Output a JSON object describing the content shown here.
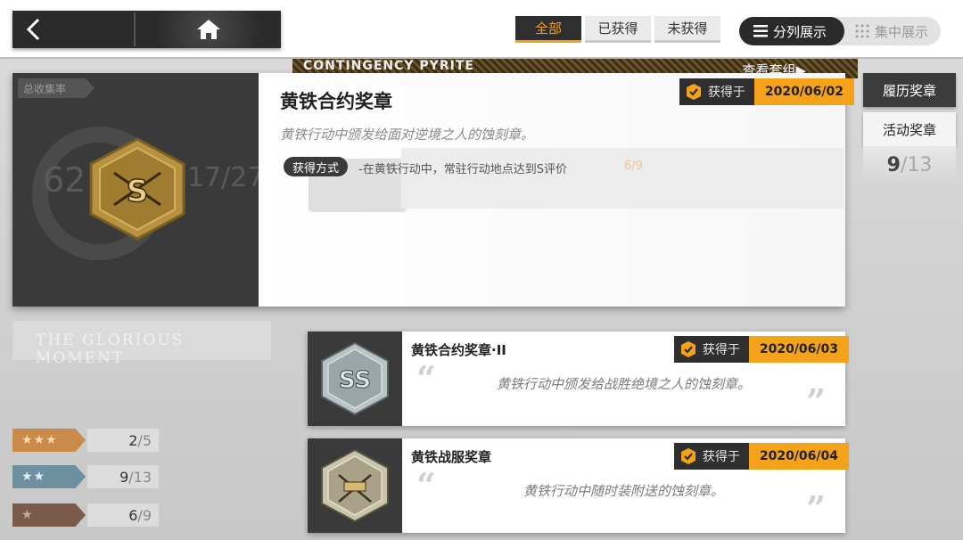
{
  "nav": {
    "back_icon": "chevron-left-icon",
    "home_icon": "home-icon"
  },
  "filters": [
    {
      "label": "全部",
      "active": true
    },
    {
      "label": "已获得",
      "active": false
    },
    {
      "label": "未获得",
      "active": false
    }
  ],
  "view_toggle": {
    "column_label": "分列展示",
    "focus_label": "集中展示"
  },
  "background": {
    "banner_left": "CONTINGENCY PYRITE",
    "banner_right": "查看套组▶",
    "glory_text": "THE GLORIOUS MOMENT",
    "collection_label": "总收集率",
    "collection_percent": "62",
    "collection_fraction": "17/27",
    "ghost_progress": "6/9"
  },
  "featured": {
    "title": "黄铁合约奖章",
    "description": "黄铁行动中颁发给面对逆境之人的蚀刻章。",
    "method_label": "获得方式",
    "method_text": "-在黄铁行动中，常驻行动地点达到S评价",
    "obtained_label": "获得于",
    "obtained_date": "2020/06/02"
  },
  "side_tabs": {
    "resume": "履历奖章",
    "event": "活动奖章",
    "count_num": "9",
    "count_den": "/13"
  },
  "list": [
    {
      "title": "黄铁合约奖章·II",
      "description": "黄铁行动中颁发给战胜绝境之人的蚀刻章。",
      "obtained_label": "获得于",
      "obtained_date": "2020/06/03"
    },
    {
      "title": "黄铁战服奖章",
      "description": "黄铁行动中随时装附送的蚀刻章。",
      "obtained_label": "获得于",
      "obtained_date": "2020/06/04"
    }
  ],
  "stars": [
    {
      "stars": "★★★",
      "num": "2",
      "den": "/5",
      "color": "#c98a4a"
    },
    {
      "stars": "★★",
      "num": "9",
      "den": "/13",
      "color": "#6e8fa0"
    },
    {
      "stars": "★",
      "num": "6",
      "den": "/9",
      "color": "#7a5a4a"
    }
  ],
  "colors": {
    "accent": "#f4a21a",
    "dark": "#2f2f2f"
  }
}
